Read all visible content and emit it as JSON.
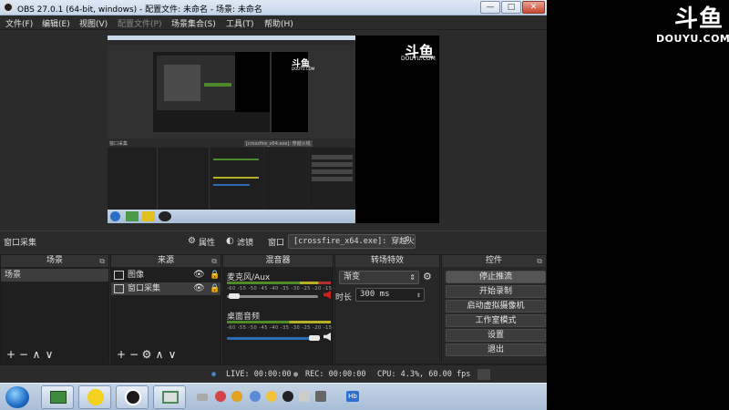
{
  "window": {
    "title": "OBS 27.0.1 (64-bit, windows) - 配置文件: 未命名 - 场景: 未命名",
    "min": "—",
    "max": "□",
    "close": "✕"
  },
  "menu": [
    "文件(F)",
    "编辑(E)",
    "视图(V)",
    "配置文件(P)",
    "场景集合(S)",
    "工具(T)",
    "帮助(H)"
  ],
  "nested": {
    "logo_text": "斗鱼",
    "logo_sub": "DOUYU.COM",
    "bar_label": "窗口采集",
    "combo": "[crossfire_x64.exe]: 穿越火线"
  },
  "preview_logo": {
    "text": "斗鱼",
    "sub": "DOUYU.COM"
  },
  "source_bar": {
    "selected_source": "窗口采集",
    "properties": "属性",
    "filters": "滤镜",
    "window_label": "窗口",
    "window_value": "[crossfire_x64.exe]: 穿越火线"
  },
  "docks": {
    "scenes": {
      "title": "场景",
      "items": [
        "场景"
      ]
    },
    "sources": {
      "title": "来源",
      "items": [
        "图像",
        "窗口采集"
      ]
    },
    "mixer": {
      "title": "混音器",
      "channels": [
        {
          "name": "麦克风/Aux",
          "muted": true
        },
        {
          "name": "桌面音频",
          "muted": false
        }
      ],
      "scale": "-60 -55 -50 -45 -40 -35 -30 -25 -20 -15 -10 -5 0"
    },
    "transitions": {
      "title": "转场特效",
      "type": "渐变",
      "duration_label": "时长",
      "duration_value": "300 ms"
    },
    "controls": {
      "title": "控件",
      "buttons": [
        "停止推流",
        "开始录制",
        "启动虚拟摄像机",
        "工作室模式",
        "设置",
        "退出"
      ]
    }
  },
  "status": {
    "live": "LIVE: 00:00:00",
    "rec": "REC: 00:00:00",
    "cpu": "CPU: 4.3%, 60.00 fps"
  },
  "colors": {
    "obs_bg": "#2b2b2b",
    "dock_bg": "#272727",
    "meter_green": "#4c8a2b",
    "meter_yellow": "#b6b025",
    "meter_red": "#b23030",
    "slider_blue": "#2c6cb6",
    "mute_red": "#d0201b"
  },
  "taskbar": {
    "apps": [
      "windows-start-icon",
      "display-app-icon",
      "music-app-icon",
      "obs-app-icon",
      "window-app-icon"
    ],
    "tray_hb": "Hb"
  },
  "side_logo": {
    "text": "斗鱼",
    "sub": "DOUYU.COM"
  }
}
